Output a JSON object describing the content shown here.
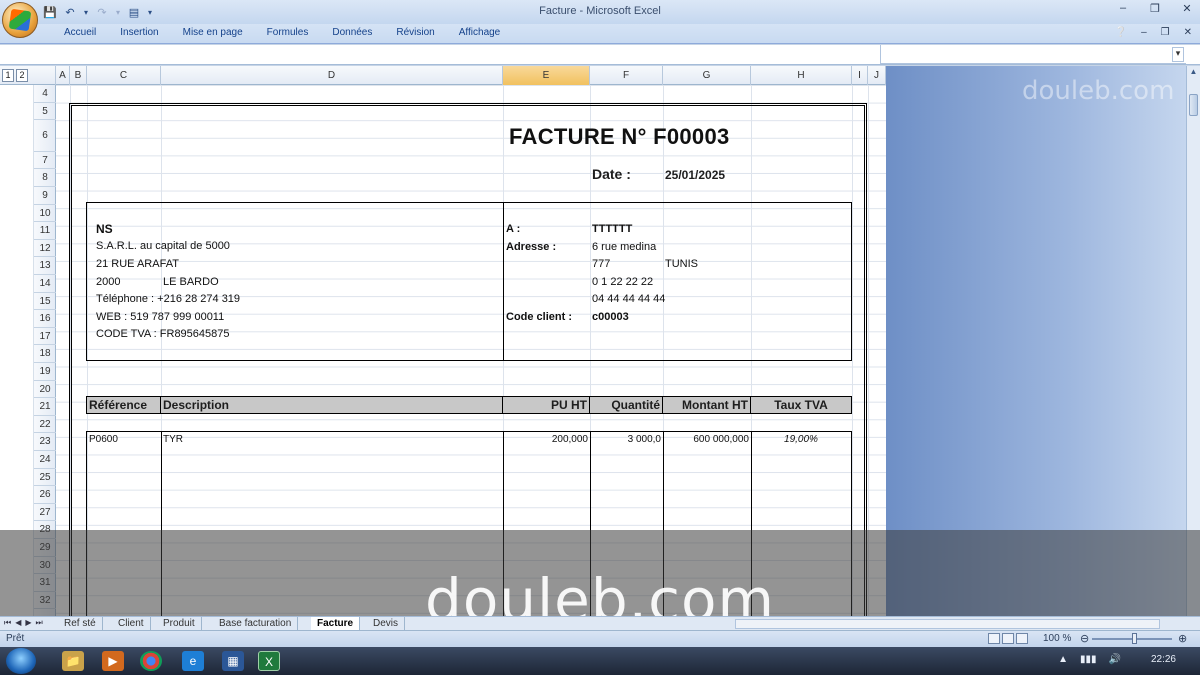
{
  "window": {
    "title": "Facture - Microsoft Excel",
    "ribbon_tabs": [
      "Accueil",
      "Insertion",
      "Mise en page",
      "Formules",
      "Données",
      "Révision",
      "Affichage"
    ]
  },
  "sheet": {
    "outline_levels": [
      "1",
      "2"
    ],
    "columns": [
      "A",
      "B",
      "C",
      "D",
      "E",
      "F",
      "G",
      "H",
      "I",
      "J"
    ],
    "selected_column": "E",
    "rows": [
      "4",
      "5",
      "6",
      "7",
      "8",
      "9",
      "10",
      "11",
      "12",
      "13",
      "14",
      "15",
      "16",
      "17",
      "18",
      "19",
      "20",
      "21",
      "22",
      "23",
      "24",
      "25",
      "26",
      "27",
      "28",
      "29",
      "30",
      "31",
      "32"
    ]
  },
  "invoice": {
    "title": "FACTURE N° F00003",
    "date_label": "Date :",
    "date_value": "25/01/2025",
    "seller": {
      "name": "NS",
      "line1": "S.A.R.L. au capital de 5000",
      "line2": "21 RUE ARAFAT",
      "postcode": "2000",
      "city": "LE BARDO",
      "phone": "Téléphone : +216 28 274 319",
      "web": "WEB : 519 787 999 00011",
      "vat": "CODE TVA : FR895645875"
    },
    "client": {
      "to_label": "A :",
      "to_value": "TTTTTT",
      "address_label": "Adresse :",
      "address_value": "6 rue medina",
      "postcode": "777",
      "city": "TUNIS",
      "phone1": "0 1 22 22 22",
      "phone2": "04 44 44 44 44",
      "code_label": "Code client :",
      "code_value": "c00003"
    },
    "table_headers": {
      "reference": "Référence",
      "description": "Description",
      "pu_ht": "PU HT",
      "quantite": "Quantité",
      "montant_ht": "Montant HT",
      "taux_tva": "Taux TVA"
    },
    "lines": [
      {
        "reference": "P0600",
        "description": "TYR",
        "pu_ht": "200,000",
        "quantite": "3 000,0",
        "montant_ht": "600 000,000",
        "taux_tva": "19,00%"
      }
    ]
  },
  "sheet_tabs": [
    "Ref sté",
    "Client",
    "Produit",
    "Base facturation",
    "Facture",
    "Devis"
  ],
  "active_tab": "Facture",
  "status": {
    "ready": "Prêt",
    "zoom": "100 %",
    "clock": "22:26"
  },
  "watermark": "douleb.com"
}
